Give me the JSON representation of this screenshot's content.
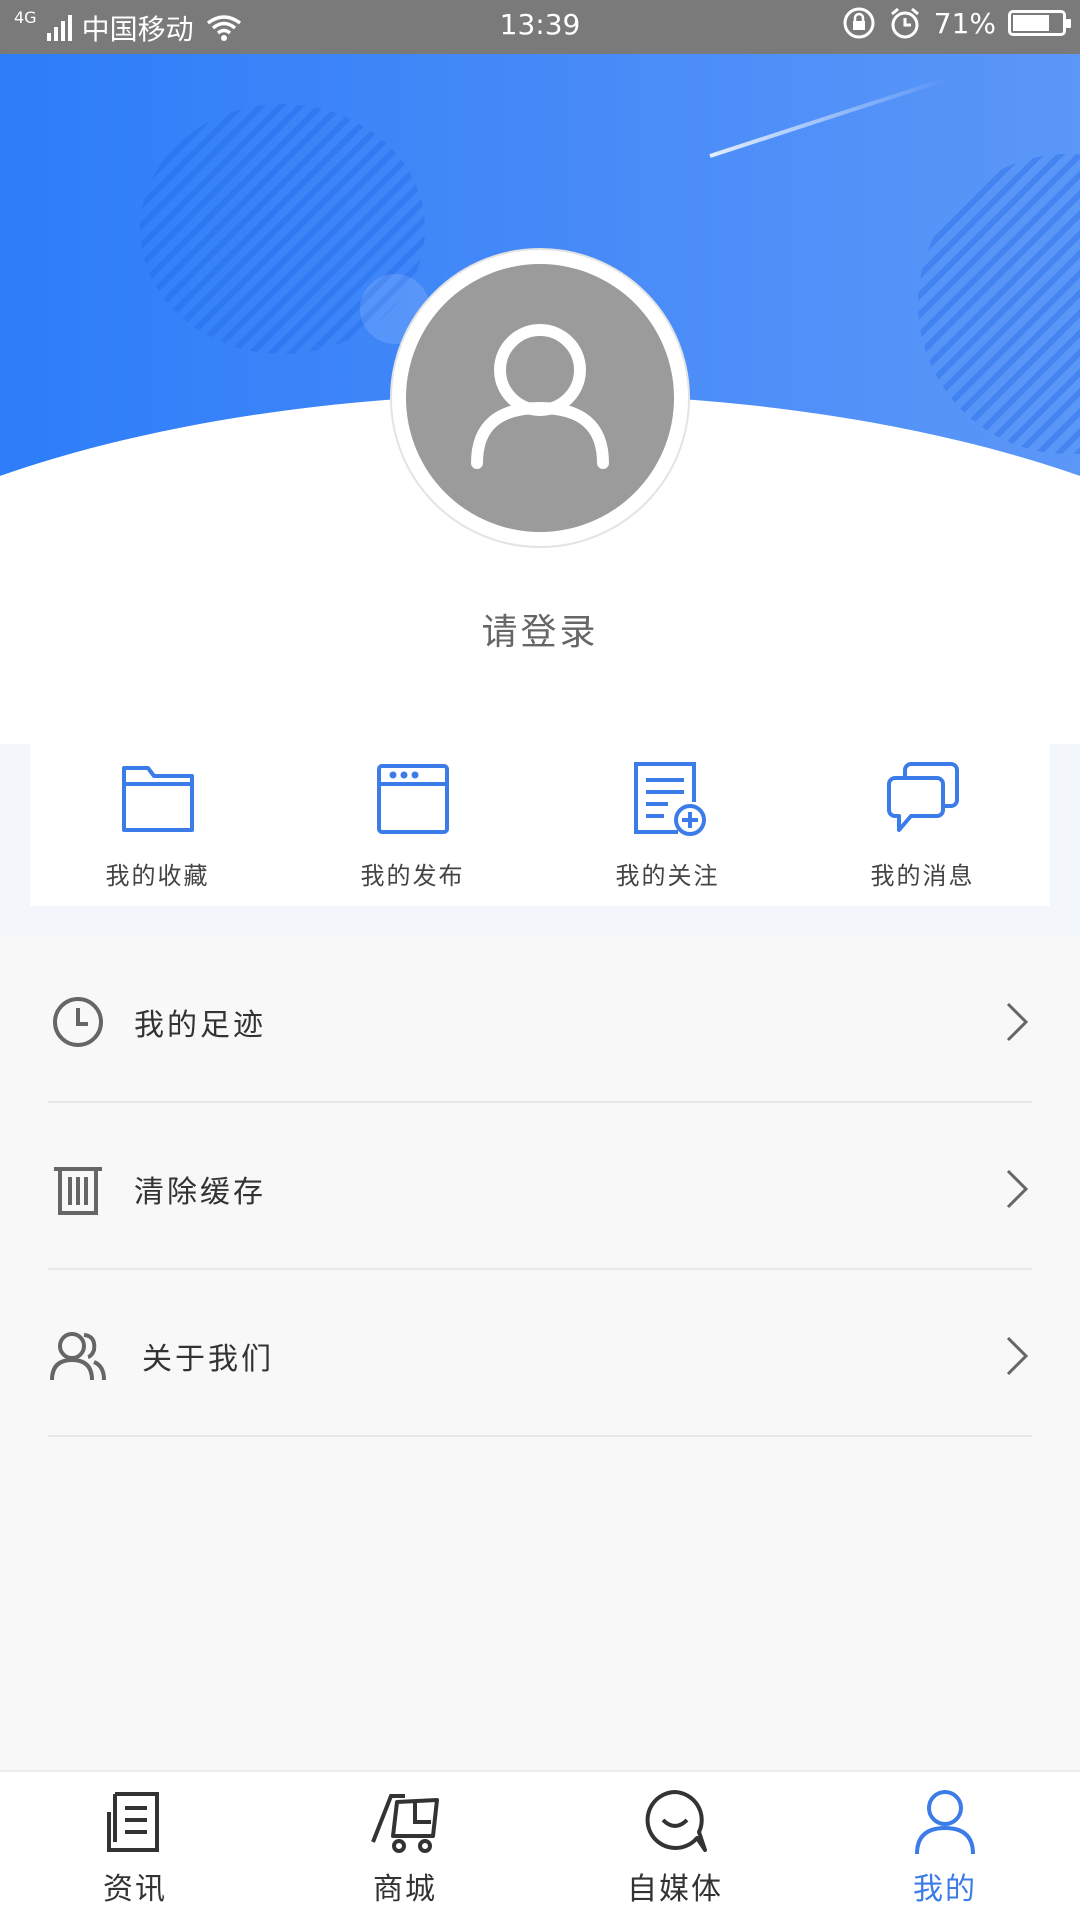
{
  "status_bar": {
    "network": "4G",
    "carrier": "中国移动",
    "time": "13:39",
    "battery": "71%"
  },
  "profile": {
    "login_prompt": "请登录"
  },
  "quick_actions": [
    {
      "label": "我的收藏",
      "icon": "folder-icon"
    },
    {
      "label": "我的发布",
      "icon": "browser-window-icon"
    },
    {
      "label": "我的关注",
      "icon": "document-add-icon"
    },
    {
      "label": "我的消息",
      "icon": "chat-bubbles-icon"
    }
  ],
  "menu": [
    {
      "label": "我的足迹",
      "icon": "clock-icon"
    },
    {
      "label": "清除缓存",
      "icon": "trash-icon"
    },
    {
      "label": "关于我们",
      "icon": "users-icon"
    }
  ],
  "bottom_nav": {
    "active": "我的",
    "items": [
      {
        "label": "资讯",
        "icon": "news-icon"
      },
      {
        "label": "商城",
        "icon": "cart-icon"
      },
      {
        "label": "自媒体",
        "icon": "smile-chat-icon"
      },
      {
        "label": "我的",
        "icon": "person-icon"
      }
    ]
  },
  "colors": {
    "accent": "#3b7ce9",
    "header_blue": "#2d7df9",
    "status_bar": "#7a7a7a"
  }
}
